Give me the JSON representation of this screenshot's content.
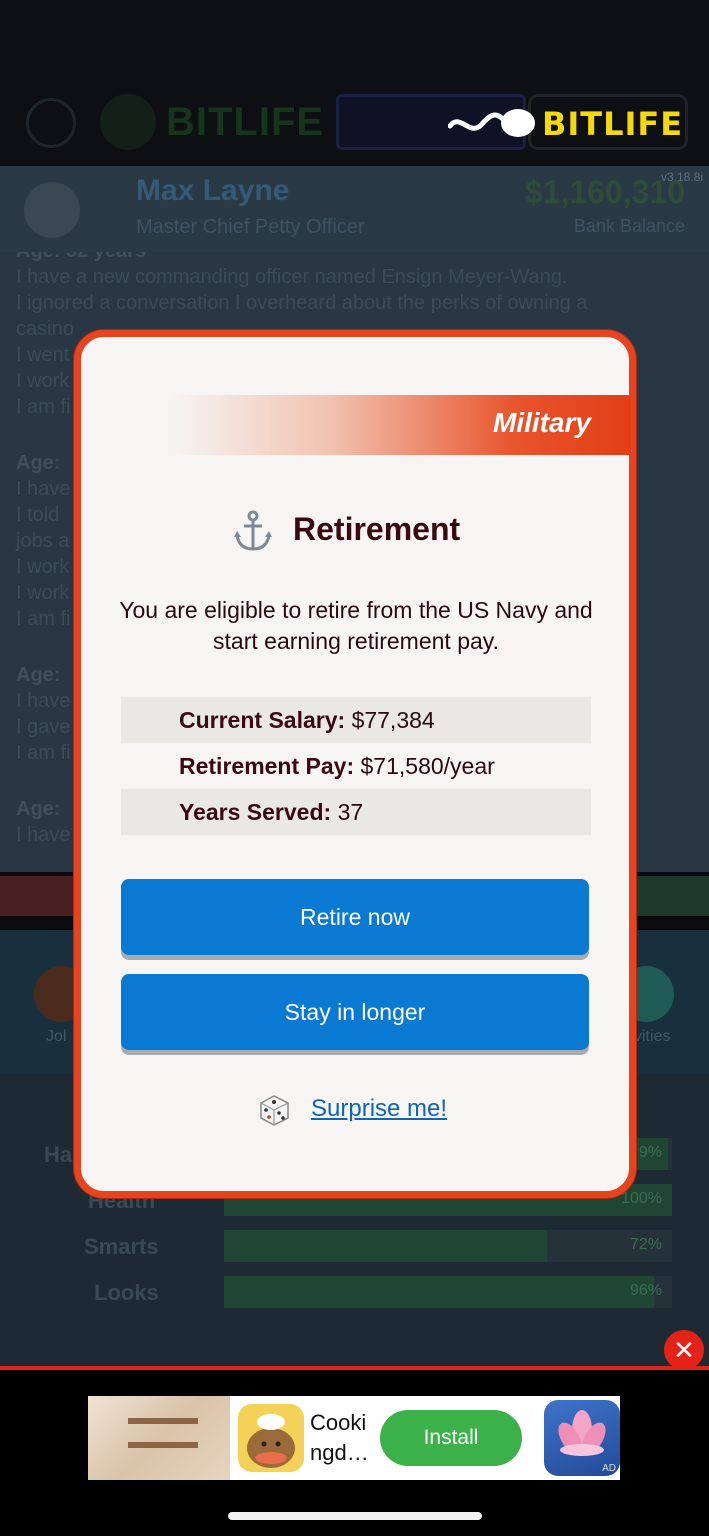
{
  "header": {
    "brand_name": "BITLIFE",
    "brand_ghost": "BITLIFE",
    "version": "v3.18.8i"
  },
  "profile": {
    "name": "Max Layne",
    "job": "Master Chief Petty Officer",
    "balance": "$1,160,310",
    "balance_label": "Bank Balance"
  },
  "log": {
    "lines": [
      "Age: 32 years",
      "I have a new commanding officer named Ensign Meyer-Wang.",
      "I ignored a conversation I overheard about the perks of owning a",
      "casino",
      "I went",
      "I work",
      "I am fi",
      "Age:",
      "I have",
      "I told",
      "jobs a",
      "I work",
      "I work",
      "I am fi",
      "Age:",
      "I have",
      "I gave",
      "I am fi",
      "Age:",
      "I have"
    ]
  },
  "nav": {
    "left_label": "Jol",
    "right_label": "vities"
  },
  "stats": [
    {
      "label": "Ha",
      "pct_text": "9%",
      "fill": 0.99
    },
    {
      "label": "Health",
      "pct_text": "100%",
      "fill": 1.0
    },
    {
      "label": "Smarts",
      "pct_text": "72%",
      "fill": 0.72
    },
    {
      "label": "Looks",
      "pct_text": "96%",
      "fill": 0.96
    }
  ],
  "modal": {
    "category": "Military",
    "title": "Retirement",
    "title_icon": "anchor-icon",
    "description": "You are eligible to retire from the US Navy and start earning retirement pay.",
    "info": [
      {
        "key": "Current Salary:",
        "value": "$77,384"
      },
      {
        "key": "Retirement Pay:",
        "value": "$71,580/year"
      },
      {
        "key": "Years Served:",
        "value": "37"
      }
    ],
    "buttons": {
      "retire_now": "Retire now",
      "stay_longer": "Stay in longer"
    },
    "surprise_label": "Surprise me!",
    "colors": {
      "border": "#e8431f",
      "button": "#0a79d1",
      "title_text": "#3a0a10",
      "link": "#1065b3"
    }
  },
  "ad": {
    "close": "✕",
    "app_title": "Cooki ngd…",
    "install_label": "Install",
    "tag": "AD"
  }
}
